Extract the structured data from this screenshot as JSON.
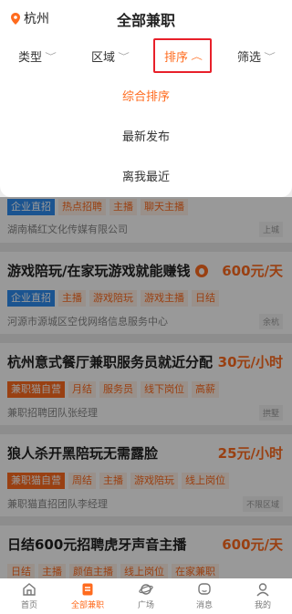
{
  "header": {
    "location": "杭州",
    "title": "全部兼职"
  },
  "filters": [
    {
      "label": "类型"
    },
    {
      "label": "区域"
    },
    {
      "label": "排序"
    },
    {
      "label": "筛选"
    }
  ],
  "sort_menu": {
    "options": [
      "综合排序",
      "最新发布",
      "离我最近"
    ],
    "selected": "综合排序"
  },
  "jobs": [
    {
      "title": "",
      "price": "",
      "tags": [
        "企业直招",
        "热点招聘",
        "主播",
        "聊天主播"
      ],
      "company": "湖南橘红文化传媒有限公司",
      "area": "上城"
    },
    {
      "title": "游戏陪玩/在家玩游戏就能赚钱",
      "price": "600元/天",
      "tags": [
        "企业直招",
        "主播",
        "游戏陪玩",
        "游戏主播",
        "日结"
      ],
      "company": "河源市源城区空伐网络信息服务中心",
      "area": "余杭"
    },
    {
      "title": "杭州意式餐厅兼职服务员就近分配",
      "price": "30元/小时",
      "tags": [
        "兼职猫自营",
        "月结",
        "服务员",
        "线下岗位",
        "高薪"
      ],
      "company": "兼职招聘团队张经理",
      "area": "拱墅"
    },
    {
      "title": "狼人杀开黑陪玩无需露脸",
      "price": "25元/小时",
      "tags": [
        "兼职猫自营",
        "周结",
        "主播",
        "游戏陪玩",
        "线上岗位"
      ],
      "company": "兼职猫直招团队李经理",
      "area": "不限区域"
    },
    {
      "title": "日结600元招聘虎牙声音主播",
      "price": "600元/天",
      "tags": [
        "日结",
        "主播",
        "颜值主播",
        "线上岗位",
        "在家兼职"
      ],
      "company": "",
      "area": ""
    }
  ],
  "bottom_nav": [
    {
      "label": "首页",
      "icon": "home-icon"
    },
    {
      "label": "全部兼职",
      "icon": "document-icon"
    },
    {
      "label": "广场",
      "icon": "planet-icon"
    },
    {
      "label": "消息",
      "icon": "message-icon"
    },
    {
      "label": "我的",
      "icon": "profile-icon"
    }
  ],
  "colors": {
    "accent": "#ff6b1e",
    "highlight_border": "#e8202a",
    "enterprise_tag": "#2d8cf0"
  }
}
